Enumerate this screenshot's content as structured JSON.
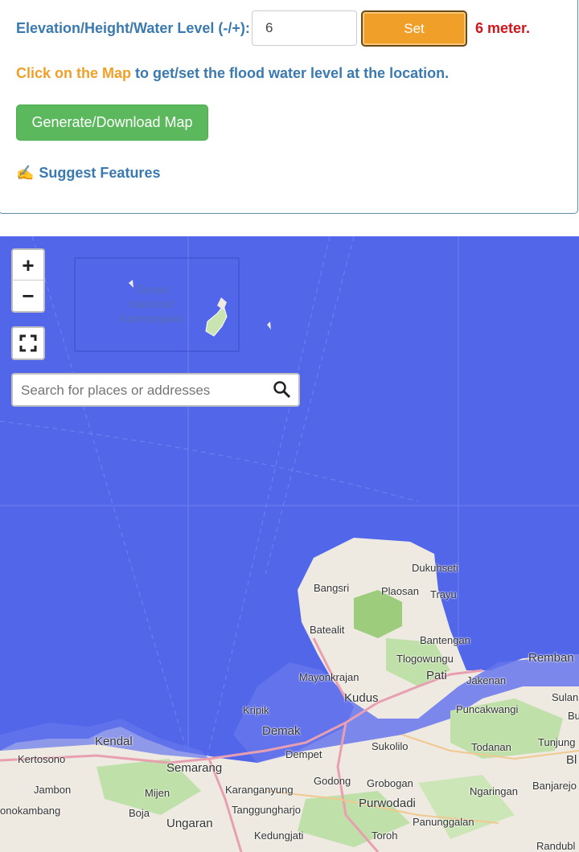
{
  "controls": {
    "elevation_label": "Elevation/Height/Water Level (-/+):",
    "elevation_value": "6",
    "set_label": "Set",
    "meter_text": "6 meter.",
    "hint_link": "Click on the Map",
    "hint_rest": " to get/set the flood water level at the location.",
    "generate_label": "Generate/Download Map",
    "suggest_icon": "✍",
    "suggest_label": "Suggest Features"
  },
  "map": {
    "zoom_in": "+",
    "zoom_out": "−",
    "search_placeholder": "Search for places or addresses",
    "icons": {
      "fullscreen": "fullscreen-icon",
      "search": "search-icon"
    },
    "colors": {
      "flood": "#5266ea",
      "land": "#eeeae2",
      "forest": "#bfe0a8",
      "road": "#e8a0b0"
    },
    "water_label": [
      "Taman",
      "Nasional",
      "Karimunjawa"
    ],
    "places": {
      "dukuhseti": "Dukuhseti",
      "bangsri": "Bangsri",
      "plaosan": "Plaosan",
      "trayu": "Trayu",
      "batealit": "Batealit",
      "bantengan": "Bantengan",
      "tlogowungu": "Tlogowungu",
      "rembang": "Remban",
      "mayonkrajan": "Mayonkrajan",
      "pati": "Pati",
      "jakenan": "Jakenan",
      "kudus": "Kudus",
      "sulan": "Sulan",
      "kripik": "Kripik",
      "puncakwangi": "Puncakwangi",
      "bu": "Bu",
      "kendal": "Kendal",
      "demak": "Demak",
      "tunjung": "Tunjung",
      "kertosono": "Kertosono",
      "dempet": "Dempet",
      "sukolilo": "Sukolilo",
      "todanan": "Todanan",
      "bl": "Bl",
      "semarang": "Semarang",
      "jambon": "Jambon",
      "mijen": "Mijen",
      "karanganyung": "Karanganyung",
      "godong": "Godong",
      "grobogan": "Grobogan",
      "ngaringan": "Ngaringan",
      "banjarejo": "Banjarejo",
      "onokambang": "onokambang",
      "boja": "Boja",
      "tanggungharjo": "Tanggungharjo",
      "purwodadi": "Purwodadi",
      "ungaran": "Ungaran",
      "panunggalan": "Panunggalan",
      "kedungjati": "Kedungjati",
      "toroh": "Toroh",
      "randubl": "Randubl"
    }
  }
}
